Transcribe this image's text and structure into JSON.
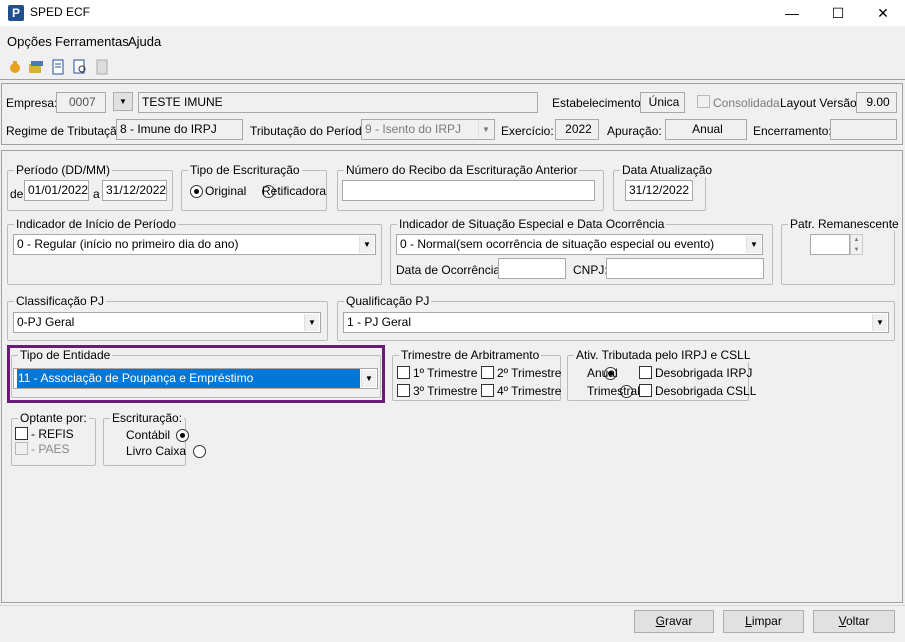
{
  "window": {
    "title": "SPED ECF",
    "minimize": "—",
    "maximize": "☐",
    "close": "✕"
  },
  "menu": [
    "Opções",
    "Ferramentas",
    "Ajuda"
  ],
  "header": {
    "empresa_label": "Empresa:",
    "empresa_code": "0007",
    "empresa_name": "TESTE IMUNE",
    "estab_label": "Estabelecimento:",
    "estab_value": "Única",
    "consolidada_label": "Consolidada",
    "layout_label": "Layout Versão:",
    "layout_value": "9.00",
    "regime_label": "Regime de Tributação:",
    "regime_value": "8 - Imune do IRPJ",
    "tribut_label": "Tributação do Período:",
    "tribut_value": "9 - Isento do IRPJ",
    "exercicio_label": "Exercício:",
    "exercicio_value": "2022",
    "apuracao_label": "Apuração:",
    "apuracao_value": "Anual",
    "encerramento_label": "Encerramento:",
    "encerramento_value": ""
  },
  "periodo": {
    "legend": "Período (DD/MM)",
    "de_label": "de",
    "de_value": "01/01/2022",
    "a_label": "a",
    "a_value": "31/12/2022"
  },
  "tipo_escrit": {
    "legend": "Tipo de Escrituração",
    "original": "Original",
    "retificadora": "Retificadora"
  },
  "recibo": {
    "legend": "Número do Recibo da Escrituração Anterior",
    "value": ""
  },
  "data_atual": {
    "legend": "Data Atualização",
    "value": "31/12/2022"
  },
  "indicador_inicio": {
    "legend": "Indicador de Início de Período",
    "value": "0 - Regular (início no primeiro dia do ano)"
  },
  "situacao": {
    "legend": "Indicador de Situação Especial e Data Ocorrência",
    "value": "0 - Normal(sem ocorrência de situação especial ou evento)",
    "data_label": "Data de Ocorrência:",
    "cnpj_label": "CNPJ:"
  },
  "patr": {
    "legend": "Patr. Remanescente"
  },
  "classificacao": {
    "legend": "Classificação PJ",
    "value": "0-PJ Geral"
  },
  "qualificacao": {
    "legend": "Qualificação PJ",
    "value": "1 - PJ Geral"
  },
  "entidade": {
    "legend": "Tipo de Entidade",
    "value": "11 - Associação de Poupança e Empréstimo"
  },
  "trimestre": {
    "legend": "Trimestre de Arbitramento",
    "t1": "1º Trimestre",
    "t2": "2º Trimestre",
    "t3": "3º Trimestre",
    "t4": "4º Trimestre"
  },
  "ativ": {
    "legend": "Ativ. Tributada pelo IRPJ e CSLL",
    "anual": "Anual",
    "trimestral": "Trimestral",
    "desob_irpj": "Desobrigada IRPJ",
    "desob_csll": "Desobrigada CSLL"
  },
  "optante": {
    "legend": "Optante por:",
    "refis": "- REFIS",
    "paes": "- PAES"
  },
  "escrituracao": {
    "legend": "Escrituração:",
    "contabil": "Contábil",
    "livro": "Livro Caixa"
  },
  "buttons": {
    "gravar_u": "G",
    "gravar_rest": "ravar",
    "limpar_u": "L",
    "limpar_rest": "impar",
    "voltar_u": "V",
    "voltar_rest": "oltar"
  },
  "colors": {
    "selection": "#0078d7",
    "highlight_border": "#6a1b7a"
  }
}
